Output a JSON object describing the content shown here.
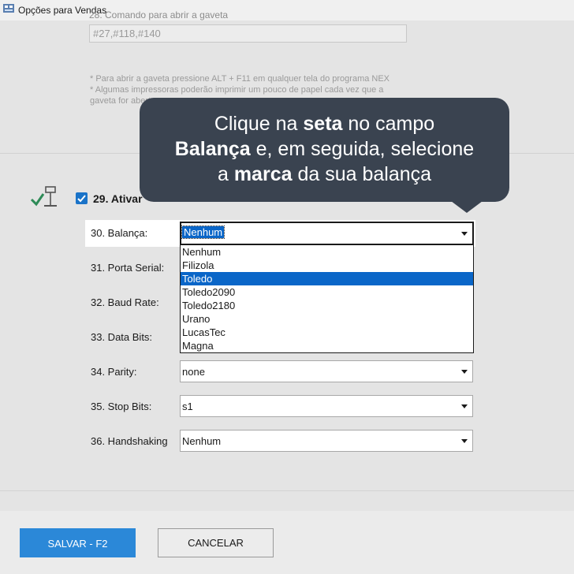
{
  "window": {
    "title": "Opções para Vendas"
  },
  "drawer": {
    "label": "28. Comando para abrir a gaveta",
    "value": "#27,#118,#140",
    "notes": [
      "* Para abrir a gaveta pressione ALT + F11 em qualquer tela do programa NEX",
      "* Algumas impressoras poderão imprimir um pouco de papel cada vez que a",
      "gaveta for aberta"
    ]
  },
  "scale_section": {
    "icon": "scale-check-icon",
    "checkbox_checked": true,
    "activate_label": "29. Ativar"
  },
  "fields": {
    "balanca": {
      "label": "30. Balança:",
      "value": "Nenhum"
    },
    "porta_serial": {
      "label": "31. Porta Serial:"
    },
    "baud_rate": {
      "label": "32. Baud Rate:"
    },
    "data_bits": {
      "label": "33. Data Bits:"
    },
    "parity": {
      "label": "34. Parity:",
      "value": "none"
    },
    "stop_bits": {
      "label": "35. Stop Bits:",
      "value": "s1"
    },
    "handshaking": {
      "label": "36. Handshaking",
      "value": "Nenhum"
    }
  },
  "dropdown": {
    "options": [
      "Nenhum",
      "Filizola",
      "Toledo",
      "Toledo2090",
      "Toledo2180",
      "Urano",
      "LucasTec",
      "Magna"
    ],
    "highlighted": "Toledo"
  },
  "buttons": {
    "save": "SALVAR - F2",
    "cancel": "CANCELAR"
  },
  "tooltip": {
    "t1": "Clique na ",
    "b1": "seta",
    "t2": " no campo",
    "b2": "Balança",
    "t3": " e, em seguida, selecione",
    "t4": "a ",
    "b3": "marca",
    "t5": " da sua balança"
  },
  "colors": {
    "accent": "#2b88d8",
    "selection": "#0a66c8",
    "tooltip_bg": "#3a4350",
    "scale_icon": "#2e8b57"
  }
}
